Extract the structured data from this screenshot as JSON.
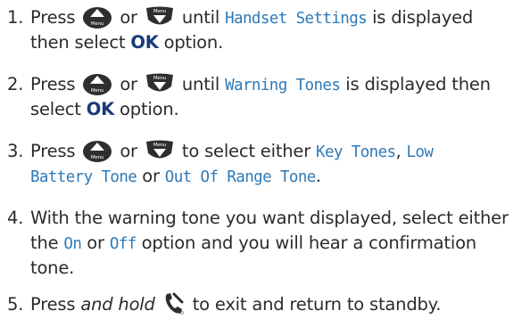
{
  "steps": [
    {
      "number": "1.",
      "t1": "Press",
      "or": "or",
      "t2": "until",
      "lcd": "Handset Settings",
      "t3": "is displayed",
      "t4": "then select",
      "ok": "OK",
      "t5": "option."
    },
    {
      "number": "2.",
      "t1": "Press",
      "or": "or",
      "t2": "until",
      "lcd": "Warning Tones",
      "t3": "is displayed then",
      "t4": "select",
      "ok": "OK",
      "t5": "option."
    },
    {
      "number": "3.",
      "t1": "Press",
      "or": "or",
      "t2": "to select either",
      "lcd1": "Key Tones",
      "comma": ",",
      "lcd2a": "Low",
      "lcd2b": "Battery Tone",
      "t3": "or",
      "lcd3": "Out Of Range Tone",
      "t4": "."
    },
    {
      "number": "4.",
      "line1": "With the warning tone you want displayed, select either",
      "t1": "the",
      "lcd1": "On",
      "t2": "or",
      "lcd2": "Off",
      "t3": "option and you will hear a confirmation",
      "line3": "tone."
    },
    {
      "number": "5.",
      "t1": "Press",
      "t2": "and hold",
      "t3": "to exit and return to standby."
    }
  ],
  "icons": {
    "up_button": "up-arrow-button-icon",
    "menu_down_button": "menu-down-arrow-button-icon",
    "end_call_button": "end-call-handset-icon",
    "menu_label": "Menu"
  }
}
